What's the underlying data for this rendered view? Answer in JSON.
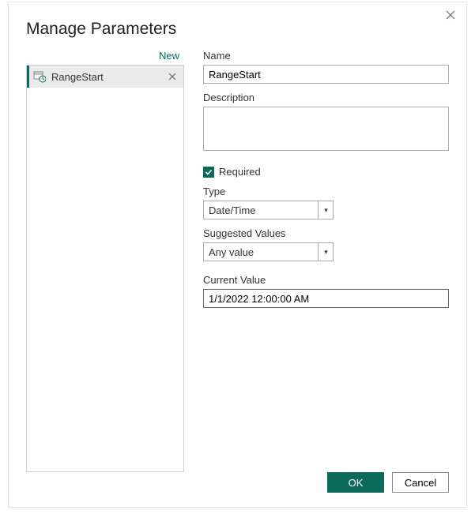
{
  "dialog": {
    "title": "Manage Parameters",
    "new_label": "New"
  },
  "param_list": {
    "items": [
      {
        "name": "RangeStart"
      }
    ]
  },
  "form": {
    "name_label": "Name",
    "name_value": "RangeStart",
    "description_label": "Description",
    "description_value": "",
    "required_label": "Required",
    "required_checked": true,
    "type_label": "Type",
    "type_value": "Date/Time",
    "suggested_label": "Suggested Values",
    "suggested_value": "Any value",
    "current_label": "Current Value",
    "current_value": "1/1/2022 12:00:00 AM"
  },
  "buttons": {
    "ok": "OK",
    "cancel": "Cancel"
  },
  "colors": {
    "accent": "#0b6a5a"
  }
}
